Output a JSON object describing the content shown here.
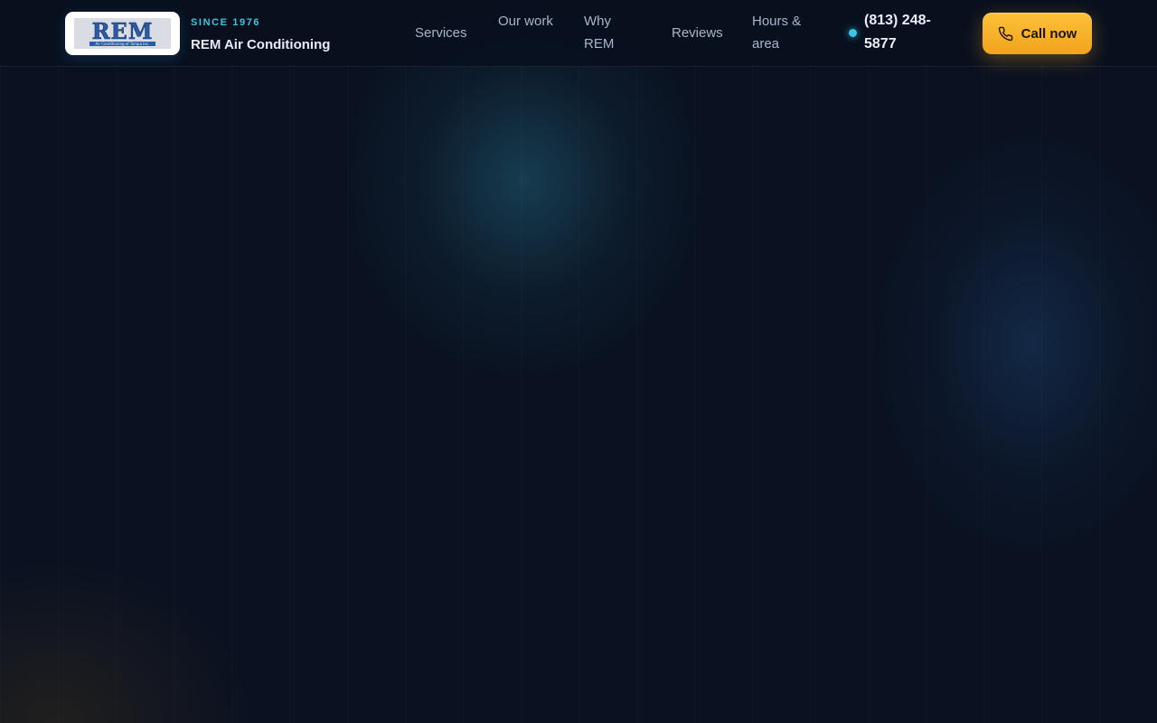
{
  "header": {
    "logo": {
      "word": "REM",
      "sub": "Air Conditioning of Tampa Inc."
    },
    "brand_tag": "SINCE 1976",
    "brand_name": "REM Air Conditioning",
    "nav": {
      "services": "Services",
      "our_work": "Our work",
      "why_rem": "Why REM",
      "reviews": "Reviews",
      "hours_area": "Hours & area"
    },
    "phone": "(813) 248-5877",
    "status_color": "#36c6e6",
    "cta": {
      "label": "Call now",
      "icon": "phone-icon",
      "color": "#f5a623"
    }
  }
}
